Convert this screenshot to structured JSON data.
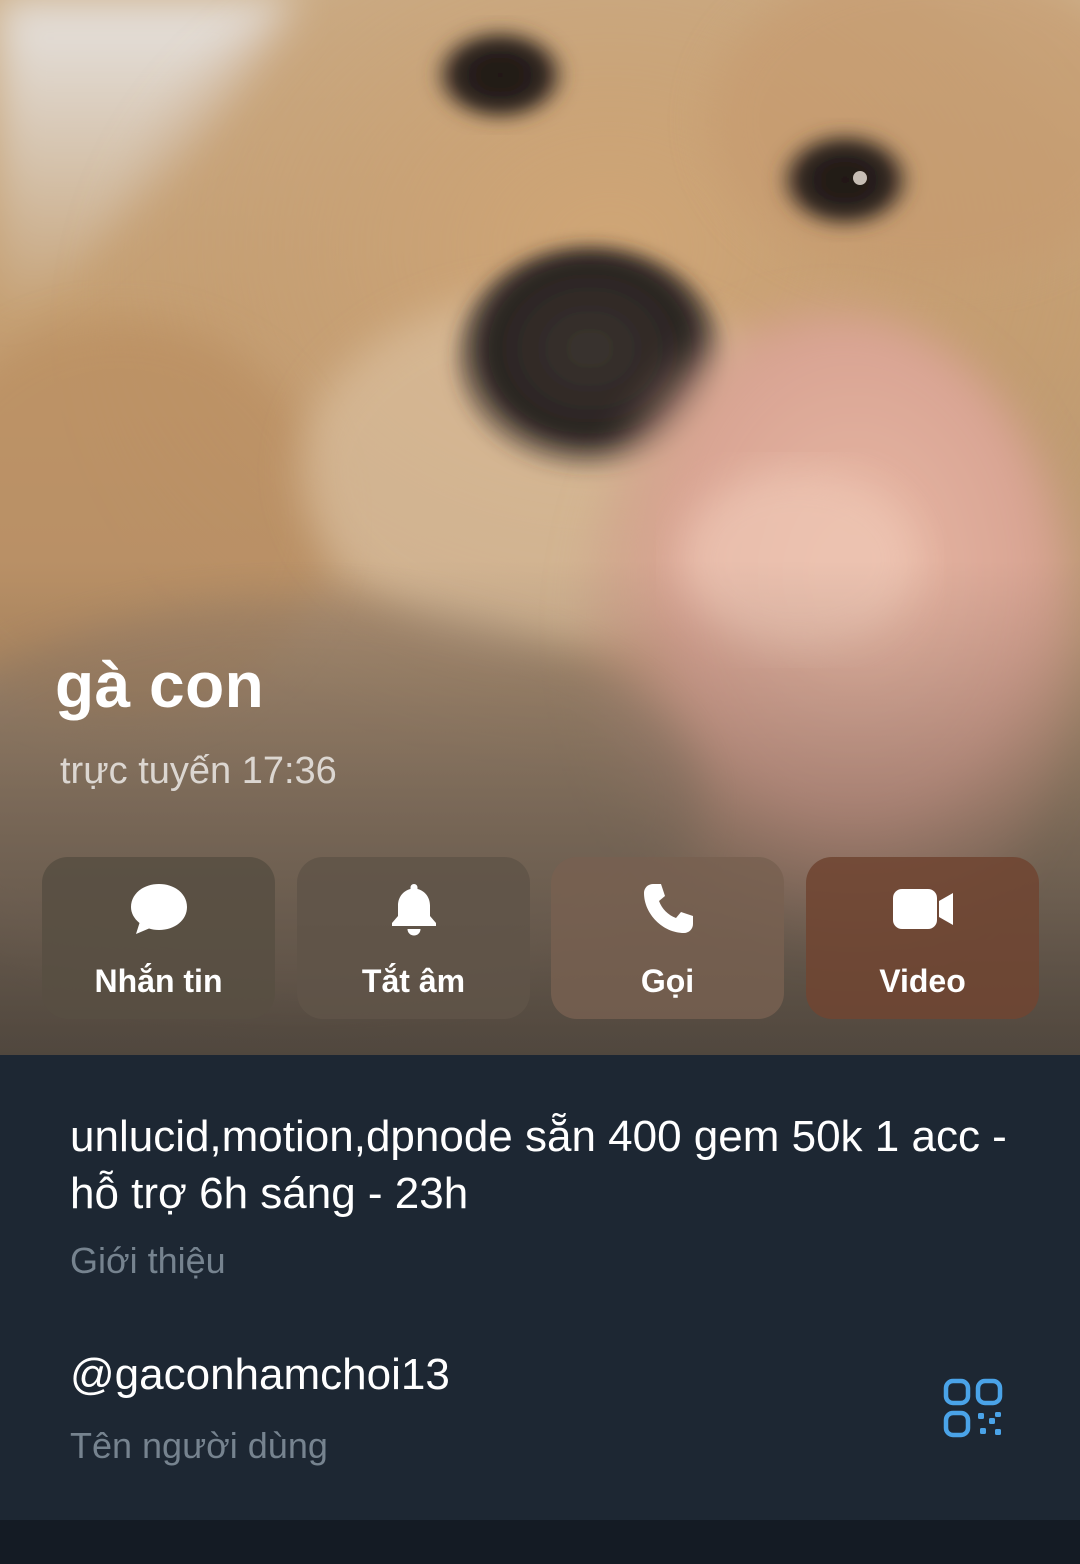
{
  "profile": {
    "name": "gà con",
    "status": "trực tuyến 17:36"
  },
  "actions": [
    {
      "label": "Nhắn tin",
      "icon": "message-icon"
    },
    {
      "label": "Tắt âm",
      "icon": "bell-icon"
    },
    {
      "label": "Gọi",
      "icon": "phone-icon"
    },
    {
      "label": "Video",
      "icon": "video-camera-icon"
    }
  ],
  "info": {
    "bio": "unlucid,motion,dpnode sẵn 400 gem 50k 1 acc - hỗ trợ 6h sáng - 23h",
    "bio_label": "Giới thiệu",
    "username": "@gaconhamchoi13",
    "username_label": "Tên người dùng"
  },
  "colors": {
    "accent": "#4aa3e8",
    "background": "#1d2733",
    "secondary_text": "#76838f"
  }
}
